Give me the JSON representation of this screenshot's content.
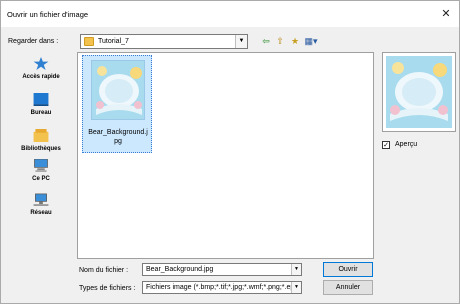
{
  "window": {
    "title": "Ouvrir un fichier d'image",
    "close_glyph": "✕"
  },
  "lookin": {
    "label": "Regarder dans :",
    "value": "Tutorial_7"
  },
  "toolbar": {
    "back_glyph": "⇦",
    "up_glyph": "⇧",
    "newfolder_glyph": "★",
    "view_glyph": "▦▾"
  },
  "places": [
    {
      "label": "Accès rapide",
      "icon": "star-icon"
    },
    {
      "label": "Bureau",
      "icon": "desktop-icon"
    },
    {
      "label": "Bibliothèques",
      "icon": "library-icon"
    },
    {
      "label": "Ce PC",
      "icon": "computer-icon"
    },
    {
      "label": "Réseau",
      "icon": "network-icon"
    }
  ],
  "files": [
    {
      "name": "Bear_Background.jpg",
      "name_line1": "Bear_Background.j",
      "name_line2": "pg"
    }
  ],
  "preview": {
    "checkbox_label": "Aperçu",
    "checked": true,
    "check_glyph": "✓"
  },
  "filename": {
    "label": "Nom du fichier :",
    "value": "Bear_Background.jpg"
  },
  "filetype": {
    "label": "Types de fichiers :",
    "value": "Fichiers image (*.bmp;*.tif;*.jpg;*.wmf;*.png;*.eps"
  },
  "buttons": {
    "open": "Ouvrir",
    "cancel": "Annuler"
  },
  "dropdown_glyph": "▼",
  "colors": {
    "selection": "#cce8ff",
    "accent": "#0078d7",
    "folder": "#f3c24d"
  }
}
